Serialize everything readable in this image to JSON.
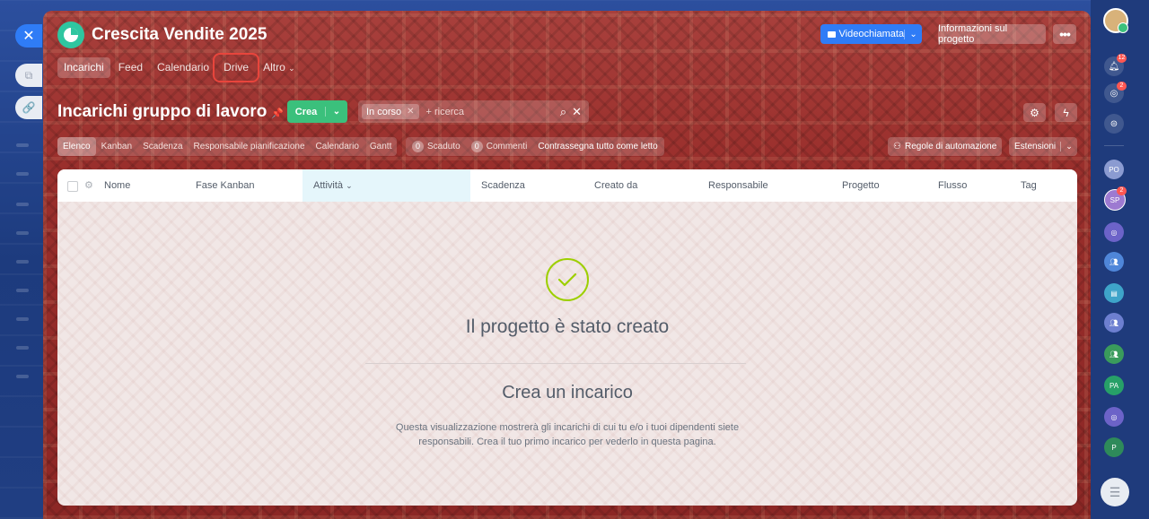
{
  "project": {
    "title": "Crescita Vendite 2025"
  },
  "nav_tabs": [
    "Incarichi",
    "Feed",
    "Calendario",
    "Drive",
    "Altro"
  ],
  "header_actions": {
    "video_call": "Videochiamata",
    "project_info": "Informazioni sul progetto",
    "more": "•••"
  },
  "toolbar": {
    "section_title": "Incarichi gruppo di lavoro",
    "create_label": "Crea",
    "filter_chip": "In corso",
    "search_placeholder": "+ ricerca"
  },
  "views": [
    "Elenco",
    "Kanban",
    "Scadenza",
    "Responsabile pianificazione",
    "Calendario",
    "Gantt"
  ],
  "counters": {
    "overdue_count": "0",
    "overdue_label": "Scaduto",
    "comments_count": "0",
    "comments_label": "Commenti",
    "mark_all_read": "Contrassegna tutto come letto"
  },
  "right_actions": {
    "automation": "Regole di automazione",
    "extensions": "Estensioni"
  },
  "columns": [
    "Nome",
    "Fase Kanban",
    "Attività",
    "Scadenza",
    "Creato da",
    "Responsabile",
    "Progetto",
    "Flusso",
    "Tag"
  ],
  "sorted_column": "Attività",
  "empty_state": {
    "title": "Il progetto è stato creato",
    "subtitle": "Crea un incarico",
    "description": "Questa visualizzazione mostrerà gli incarichi di cui tu e/o i tuoi dipendenti siete responsabili. Crea il tuo primo incarico per vederlo in questa pagina."
  },
  "right_rail": {
    "notifications_badge": "12",
    "activity_badge": "2",
    "group_badge": "2",
    "groups": [
      "PO",
      "SP",
      "PA",
      "P"
    ]
  },
  "colors": {
    "accent_blue": "#2f7cf6",
    "create_green": "#3bc07c",
    "success_check": "#9dcf00",
    "highlight_red": "#e8453c"
  }
}
